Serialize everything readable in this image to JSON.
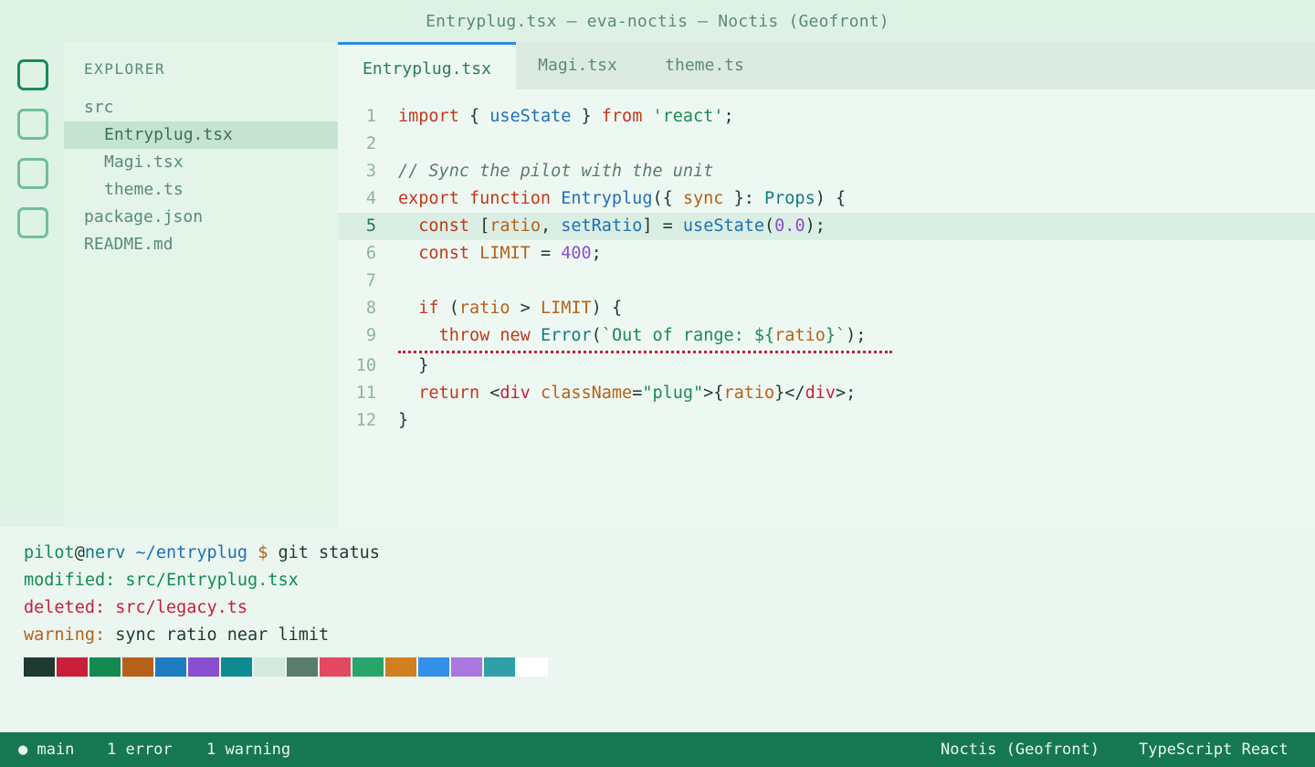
{
  "window": {
    "title": "Entryplug.tsx — eva-noctis — Noctis (Geofront)"
  },
  "activity_bar": {
    "buttons": [
      {
        "name": "files-icon",
        "active": true
      },
      {
        "name": "search-icon",
        "active": false
      },
      {
        "name": "source-control-icon",
        "active": false
      },
      {
        "name": "extensions-icon",
        "active": false
      }
    ]
  },
  "explorer": {
    "title": "EXPLORER",
    "items": [
      {
        "label": "src",
        "depth": 0,
        "selected": false
      },
      {
        "label": "Entryplug.tsx",
        "depth": 1,
        "selected": true
      },
      {
        "label": "Magi.tsx",
        "depth": 1,
        "selected": false
      },
      {
        "label": "theme.ts",
        "depth": 1,
        "selected": false
      },
      {
        "label": "package.json",
        "depth": 0,
        "selected": false
      },
      {
        "label": "README.md",
        "depth": 0,
        "selected": false
      }
    ]
  },
  "tabs": [
    {
      "label": "Entryplug.tsx",
      "active": true
    },
    {
      "label": "Magi.tsx",
      "active": false
    },
    {
      "label": "theme.ts",
      "active": false
    }
  ],
  "editor": {
    "current_line": 5,
    "lines": [
      {
        "n": "1",
        "tokens": [
          [
            "kw",
            "import"
          ],
          [
            "pl",
            " { "
          ],
          [
            "fn",
            "useState"
          ],
          [
            "pl",
            " } "
          ],
          [
            "kw",
            "from"
          ],
          [
            "pl",
            " "
          ],
          [
            "str",
            "'react'"
          ],
          [
            "pl",
            ";"
          ]
        ]
      },
      {
        "n": "2",
        "tokens": []
      },
      {
        "n": "3",
        "tokens": [
          [
            "cmt",
            "// Sync the pilot with the unit"
          ]
        ]
      },
      {
        "n": "4",
        "tokens": [
          [
            "kw",
            "export"
          ],
          [
            "pl",
            " "
          ],
          [
            "kw",
            "function"
          ],
          [
            "pl",
            " "
          ],
          [
            "fn",
            "Entryplug"
          ],
          [
            "pl",
            "({ "
          ],
          [
            "var",
            "sync"
          ],
          [
            "pl",
            " }: "
          ],
          [
            "ty",
            "Props"
          ],
          [
            "pl",
            ") {"
          ]
        ]
      },
      {
        "n": "5",
        "tokens": [
          [
            "pl",
            "  "
          ],
          [
            "kw",
            "const"
          ],
          [
            "pl",
            " ["
          ],
          [
            "var",
            "ratio"
          ],
          [
            "pl",
            ", "
          ],
          [
            "fn",
            "setRatio"
          ],
          [
            "pl",
            "] = "
          ],
          [
            "fn",
            "useState"
          ],
          [
            "pl",
            "("
          ],
          [
            "num",
            "0.0"
          ],
          [
            "pl",
            ");"
          ]
        ]
      },
      {
        "n": "6",
        "tokens": [
          [
            "pl",
            "  "
          ],
          [
            "kw",
            "const"
          ],
          [
            "pl",
            " "
          ],
          [
            "var",
            "LIMIT"
          ],
          [
            "pl",
            " = "
          ],
          [
            "num",
            "400"
          ],
          [
            "pl",
            ";"
          ]
        ]
      },
      {
        "n": "7",
        "tokens": []
      },
      {
        "n": "8",
        "tokens": [
          [
            "pl",
            "  "
          ],
          [
            "kw",
            "if"
          ],
          [
            "pl",
            " ("
          ],
          [
            "var",
            "ratio"
          ],
          [
            "pl",
            " > "
          ],
          [
            "var",
            "LIMIT"
          ],
          [
            "pl",
            ") {"
          ]
        ]
      },
      {
        "n": "9",
        "tokens": [
          [
            "pl",
            "    "
          ],
          [
            "kw",
            "throw"
          ],
          [
            "pl",
            " "
          ],
          [
            "kw",
            "new"
          ],
          [
            "pl",
            " "
          ],
          [
            "ty",
            "Error"
          ],
          [
            "pl",
            "("
          ],
          [
            "str",
            "`Out of range: ${"
          ],
          [
            "var",
            "ratio"
          ],
          [
            "str",
            "}`"
          ],
          [
            "pl",
            ");"
          ]
        ]
      },
      {
        "n": "10",
        "tokens": [
          [
            "pl",
            "  }"
          ]
        ]
      },
      {
        "n": "11",
        "tokens": [
          [
            "pl",
            "  "
          ],
          [
            "kw",
            "return"
          ],
          [
            "pl",
            " <"
          ],
          [
            "tag",
            "div"
          ],
          [
            "pl",
            " "
          ],
          [
            "var",
            "className"
          ],
          [
            "pl",
            "="
          ],
          [
            "str",
            "\"plug\""
          ],
          [
            "pl",
            ">{"
          ],
          [
            "var",
            "ratio"
          ],
          [
            "pl",
            "}</"
          ],
          [
            "tag",
            "div"
          ],
          [
            "pl",
            ">;"
          ]
        ]
      },
      {
        "n": "12",
        "tokens": [
          [
            "pl",
            "}"
          ]
        ]
      }
    ]
  },
  "terminal": {
    "prompt_user": "pilot",
    "prompt_at": "@",
    "prompt_host": "nerv",
    "prompt_path": " ~/entryplug",
    "prompt_symbol": " $ ",
    "command": "git status",
    "modified_label": "modified:",
    "modified_value": " src/Entryplug.tsx",
    "deleted_label": "deleted:",
    "deleted_value": " src/legacy.ts",
    "warning_label": "warning:",
    "warning_value": " sync ratio near limit",
    "palette": [
      "#1f3a30",
      "#c81f3a",
      "#148a52",
      "#b5611a",
      "#1e7cc2",
      "#8a4fcf",
      "#0e8a90",
      "#d2e9dc",
      "#5b7d6e",
      "#e24860",
      "#27a56b",
      "#d08020",
      "#3590ea",
      "#a878e0",
      "#30a0a8",
      "#ffffff"
    ]
  },
  "status_bar": {
    "branch": "● main",
    "errors": "1 error",
    "warnings": "1 warning",
    "theme": "Noctis (Geofront)",
    "language": "TypeScript React"
  }
}
